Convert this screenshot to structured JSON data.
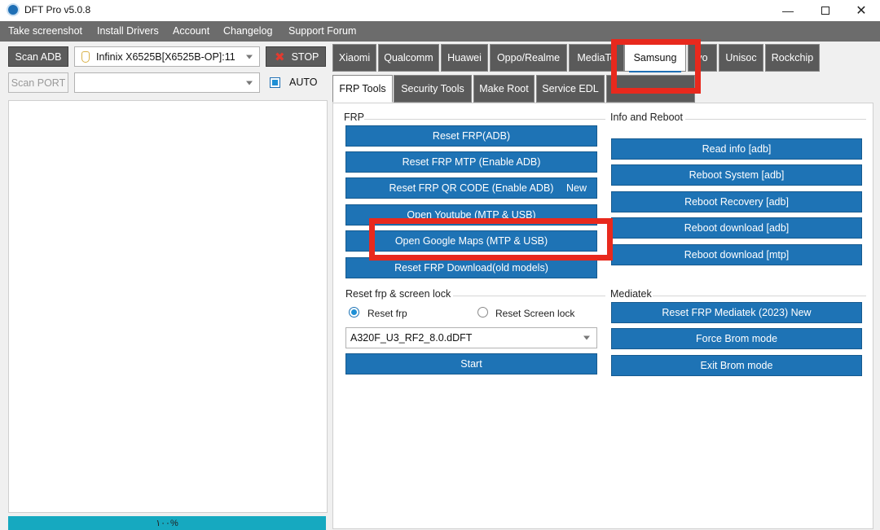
{
  "window": {
    "title": "DFT Pro v5.0.8",
    "controls": {
      "minimize": "—",
      "close": "✕"
    }
  },
  "menu": [
    "Take screenshot",
    "Install Drivers",
    "Account",
    "Changelog",
    "Support Forum"
  ],
  "left_panel": {
    "scan_adb_label": "Scan ADB",
    "device_value": "Infinix X6525B[X6525B-OP]:11",
    "stop_label": "STOP",
    "scan_port_label": "Scan PORT",
    "port_value": "",
    "auto_label": "AUTO",
    "auto_checked": true,
    "progress_text": "١٠٠%",
    "progress_percent": 100
  },
  "brand_tabs": {
    "items": [
      "Xiaomi",
      "Qualcomm",
      "Huawei",
      "Oppo/Realme",
      "MediaTek",
      "Samsung",
      "Vivo",
      "Unisoc",
      "Rockchip"
    ],
    "visible_text": [
      "Xiaomi",
      "Qualcomm",
      "Huawei",
      "Oppo/Realme",
      "MediaTe",
      "Samsung",
      "vo",
      "Unisoc",
      "Rockchip"
    ],
    "active": "Samsung"
  },
  "sub_tabs": {
    "items": [
      "FRP Tools",
      "Security Tools",
      "Make Root",
      "Service EDL"
    ],
    "active": "FRP Tools"
  },
  "frp_group": {
    "title": "FRP",
    "buttons": [
      "Reset FRP(ADB)",
      "Reset FRP MTP (Enable ADB)",
      "Reset FRP QR CODE (Enable ADB)",
      "Open Youtube (MTP & USB)",
      "Open Google Maps (MTP & USB)",
      "Reset FRP Download(old models)"
    ],
    "new_badge": "New"
  },
  "reset_lock_group": {
    "title": "Reset frp & screen lock",
    "radio_reset_frp": "Reset frp",
    "radio_reset_screen_lock": "Reset Screen lock",
    "selected": "Reset frp",
    "file_value": "A320F_U3_RF2_8.0.dDFT",
    "start_label": "Start"
  },
  "info_group": {
    "title": "Info and Reboot",
    "buttons": [
      "Read info [adb]",
      "Reboot System [adb]",
      "Reboot Recovery [adb]",
      "Reboot download [adb]",
      "Reboot download [mtp]"
    ]
  },
  "mediatek_group": {
    "title": "Mediatek",
    "buttons": [
      "Reset FRP Mediatek (2023) New",
      "Force Brom mode",
      "Exit Brom mode"
    ]
  },
  "colors": {
    "menubar": "#6c6c6c",
    "action_button": "#1e73b5",
    "highlight": "#e8291d",
    "progress": "#16a9c0"
  }
}
